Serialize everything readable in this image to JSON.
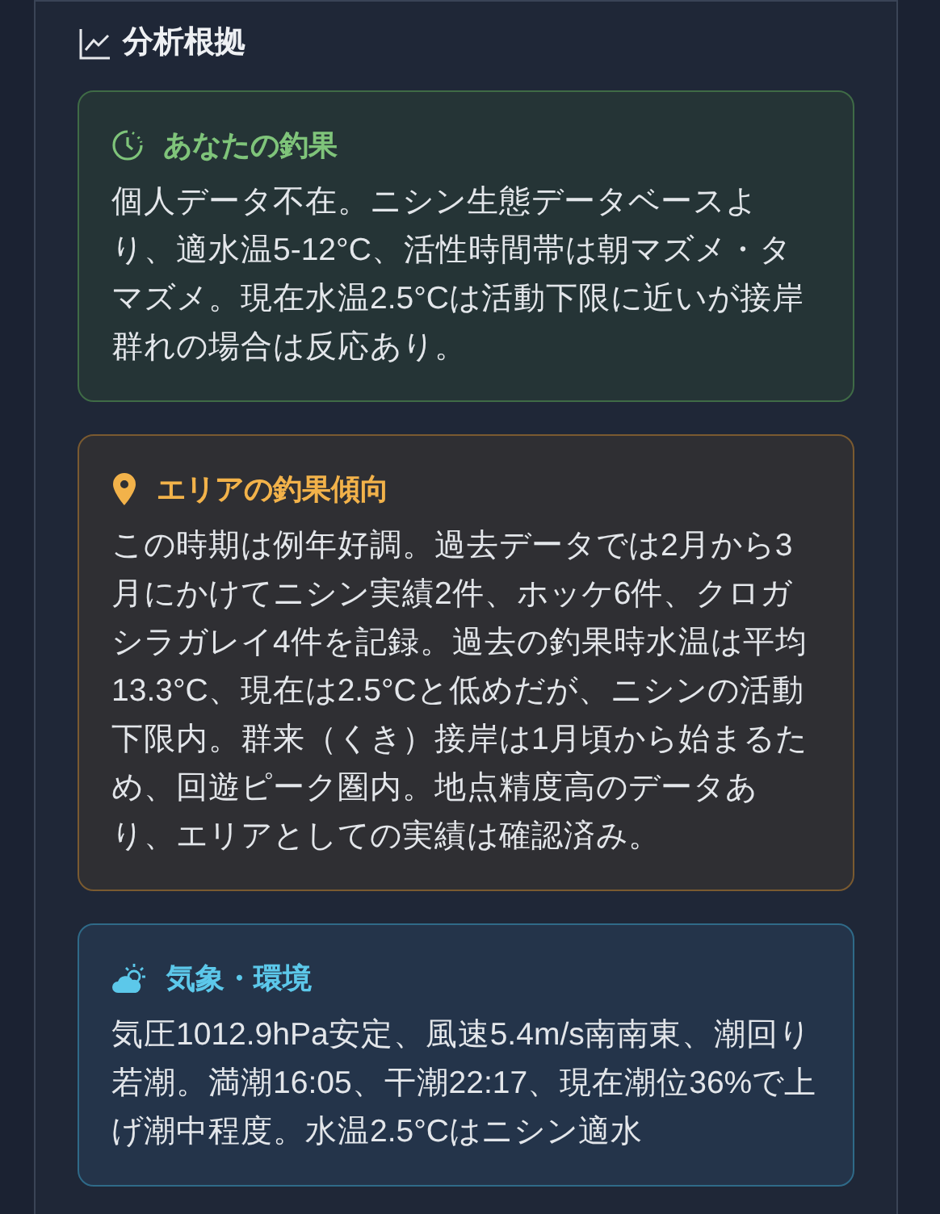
{
  "section": {
    "title": "分析根拠"
  },
  "cards": [
    {
      "kind": "history",
      "color": "#7fc47a",
      "title": "あなたの釣果",
      "body": "個人データ不在。ニシン生態データベースより、適水温5-12°C、活性時間帯は朝マズメ・タマズメ。現在水温2.5°Cは活動下限に近いが接岸群れの場合は反応あり。"
    },
    {
      "kind": "area",
      "color": "#f2b24a",
      "title": "エリアの釣果傾向",
      "body": "この時期は例年好調。過去データでは2月から3月にかけてニシン実績2件、ホッケ6件、クロガシラガレイ4件を記録。過去の釣果時水温は平均13.3°C、現在は2.5°Cと低めだが、ニシンの活動下限内。群来（くき）接岸は1月頃から始まるため、回遊ピーク圏内。地点精度高のデータあり、エリアとしての実績は確認済み。"
    },
    {
      "kind": "weather",
      "color": "#5cc8ea",
      "title": "気象・環境",
      "body": "気圧1012.9hPa安定、風速5.4m/s南南東、潮回り若潮。満潮16:05、干潮22:17、現在潮位36%で上げ潮中程度。水温2.5°Cはニシン適水"
    }
  ]
}
